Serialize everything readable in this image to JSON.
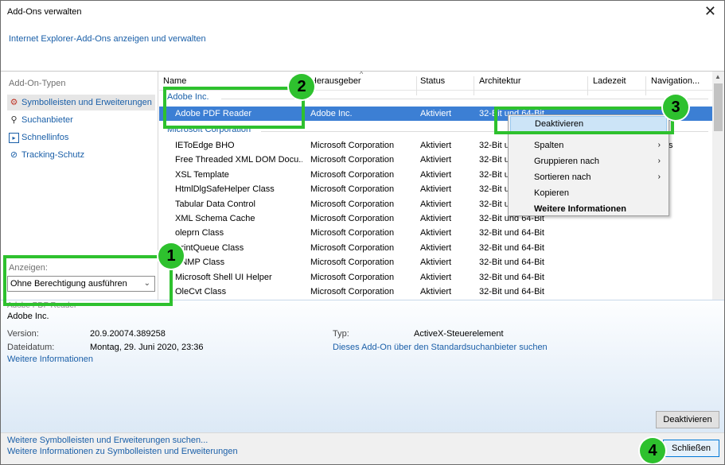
{
  "window": {
    "title": "Add-Ons verwalten",
    "subtitle": "Internet Explorer-Add-Ons anzeigen und verwalten",
    "close_glyph": "✕"
  },
  "sidebar": {
    "header": "Add-On-Typen",
    "items": [
      {
        "label": "Symbolleisten und Erweiterungen",
        "icon": "gear-blocked-icon"
      },
      {
        "label": "Suchanbieter",
        "icon": "search-icon"
      },
      {
        "label": "Schnellinfos",
        "icon": "accelerator-icon"
      },
      {
        "label": "Tracking-Schutz",
        "icon": "tracking-protection-icon"
      }
    ],
    "show_label": "Anzeigen:",
    "show_value": "Ohne Berechtigung ausführen"
  },
  "list": {
    "columns": [
      "Name",
      "Herausgeber",
      "Status",
      "Architektur",
      "Ladezeit",
      "Navigation..."
    ],
    "groups": [
      {
        "name": "Adobe Inc.",
        "rows": [
          [
            "Adobe PDF Reader",
            "Adobe Inc.",
            "Aktiviert",
            "32-Bit und 64-Bit"
          ]
        ]
      },
      {
        "name": "Microsoft Corporation",
        "rows": [
          [
            "IEToEdge BHO",
            "Microsoft Corporation",
            "Aktiviert",
            "32-Bit und 64-Bit"
          ],
          [
            "Free Threaded XML DOM Docu...",
            "Microsoft Corporation",
            "Aktiviert",
            "32-Bit und 64-Bit"
          ],
          [
            "XSL Template",
            "Microsoft Corporation",
            "Aktiviert",
            "32-Bit und 64-Bit"
          ],
          [
            "HtmlDlgSafeHelper Class",
            "Microsoft Corporation",
            "Aktiviert",
            "32-Bit und 64-Bit"
          ],
          [
            "Tabular Data Control",
            "Microsoft Corporation",
            "Aktiviert",
            "32-Bit und 64-Bit"
          ],
          [
            "XML Schema Cache",
            "Microsoft Corporation",
            "Aktiviert",
            "32-Bit und 64-Bit"
          ],
          [
            "oleprn Class",
            "Microsoft Corporation",
            "Aktiviert",
            "32-Bit und 64-Bit"
          ],
          [
            "PrintQueue Class",
            "Microsoft Corporation",
            "Aktiviert",
            "32-Bit und 64-Bit"
          ],
          [
            "SNMP Class",
            "Microsoft Corporation",
            "Aktiviert",
            "32-Bit und 64-Bit"
          ],
          [
            "Microsoft Shell UI Helper",
            "Microsoft Corporation",
            "Aktiviert",
            "32-Bit und 64-Bit"
          ],
          [
            "OleCvt Class",
            "Microsoft Corporation",
            "Aktiviert",
            "32-Bit und 64-Bit"
          ]
        ]
      }
    ],
    "row6_extra": "s"
  },
  "context_menu": {
    "items": [
      {
        "label": "Deaktivieren",
        "submenu": false
      },
      {
        "label": "Spalten",
        "submenu": true
      },
      {
        "label": "Gruppieren nach",
        "submenu": true
      },
      {
        "label": "Sortieren nach",
        "submenu": true
      },
      {
        "label": "Kopieren",
        "submenu": false
      },
      {
        "label": "Weitere Informationen",
        "submenu": false
      }
    ]
  },
  "details": {
    "name_faded": "Adobe PDF Reader",
    "publisher": "Adobe Inc.",
    "version_label": "Version:",
    "version_value": "20.9.20074.389258",
    "date_label": "Dateidatum:",
    "date_value": "Montag, 29. Juni 2020, 23:36",
    "more_info_link": "Weitere Informationen",
    "type_label": "Typ:",
    "type_value": "ActiveX-Steuerelement",
    "search_link": "Dieses Add-On über den Standardsuchanbieter suchen",
    "disable_button": "Deaktivieren"
  },
  "footer": {
    "link1": "Weitere Symbolleisten und Erweiterungen suchen...",
    "link2": "Weitere Informationen zu Symbolleisten und Erweiterungen",
    "close_button": "Schließen"
  },
  "annotations": {
    "badges": [
      "1",
      "2",
      "3",
      "4"
    ],
    "color": "#2ec12e"
  }
}
